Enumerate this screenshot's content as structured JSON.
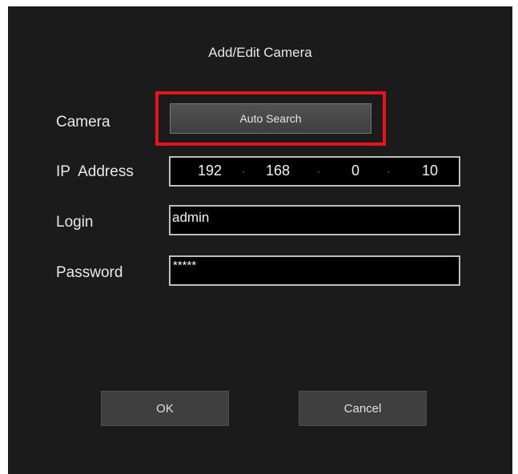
{
  "dialog": {
    "title": "Add/Edit Camera",
    "camera_label": "Camera",
    "auto_search_label": "Auto Search",
    "ip_label": "IP  Address",
    "ip_octets": [
      "192",
      "168",
      "0",
      "10"
    ],
    "login_label": "Login",
    "login_value": "admin",
    "password_label": "Password",
    "password_value": "*****",
    "ok_label": "OK",
    "cancel_label": "Cancel"
  },
  "colors": {
    "dialog_background": "#1b1b1b",
    "highlight_border": "#e8141b",
    "field_background": "#000000"
  }
}
